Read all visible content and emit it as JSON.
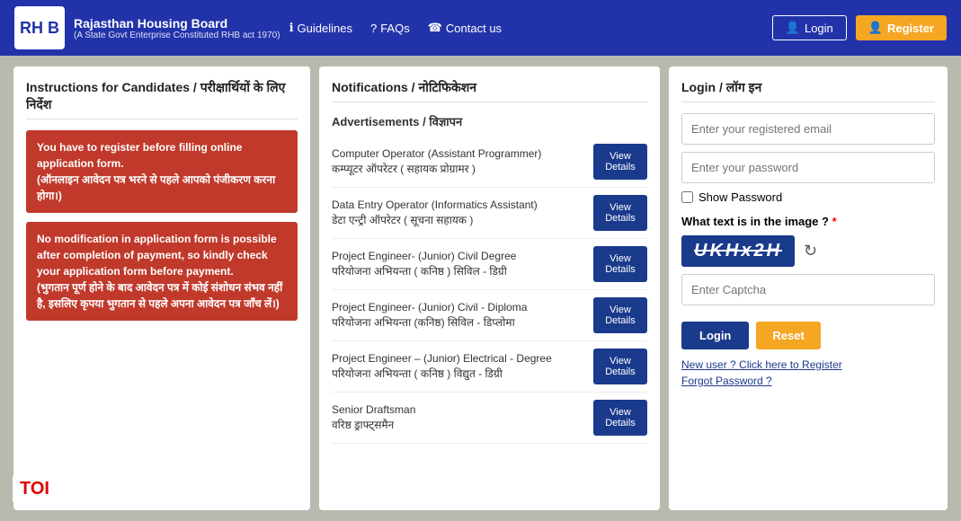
{
  "header": {
    "logo_text": "RH B",
    "org_name": "Rajasthan Housing Board",
    "org_sub": "(A State Govt Enterprise Constituted RHB act 1970)",
    "nav": [
      {
        "id": "guidelines",
        "icon": "ℹ",
        "label": "Guidelines"
      },
      {
        "id": "faqs",
        "icon": "?",
        "label": "FAQs"
      },
      {
        "id": "contact",
        "icon": "☎",
        "label": "Contact us"
      }
    ],
    "login_label": "Login",
    "register_label": "Register"
  },
  "instructions": {
    "section_title": "Instructions for Candidates / परीक्षार्थियों के लिए निर्देश",
    "boxes": [
      {
        "id": "inst1",
        "text": "You have to register before filling online application form.\n(ऑनलाइन आवेदन पत्र भरने से पहले आपको पंजीकरण करना होगा।)"
      },
      {
        "id": "inst2",
        "text": "No modification in application form is possible after completion of payment, so kindly check your application form before payment.\n(भुगतान पूर्ण होने के बाद आवेदन पत्र में कोई संशोधन संभव नहीं है, इसलिए कृपया भुगतान से पहले अपना आवेदन पत्र जाँच लें।)"
      }
    ]
  },
  "notifications": {
    "section_title": "Notifications / नोटिफिकेशन",
    "sub_title": "Advertisements / विज्ञापन",
    "items": [
      {
        "id": "notif1",
        "text": "Computer Operator (Assistant Programmer)\nकम्प्यूटर ऑपरेटर ( सहायक प्रोग्रामर )",
        "btn_label": "View\nDetails"
      },
      {
        "id": "notif2",
        "text": "Data Entry Operator (Informatics Assistant)\nडेटा एन्ट्री ऑपरेटर ( सूचना सहायक )",
        "btn_label": "View\nDetails"
      },
      {
        "id": "notif3",
        "text": "Project Engineer- (Junior) Civil Degree\nपरियोजना अभियन्ता ( कनिष्ठ ) सिविल - डिग्री",
        "btn_label": "View\nDetails"
      },
      {
        "id": "notif4",
        "text": "Project Engineer- (Junior) Civil - Diploma\nपरियोजना अभियन्ता (कनिष्ठ) सिविल - डिप्लोमा",
        "btn_label": "View\nDetails"
      },
      {
        "id": "notif5",
        "text": "Project Engineer – (Junior) Electrical - Degree\nपरियोजना अभियन्ता ( कनिष्ठ ) विद्युत - डिग्री",
        "btn_label": "View\nDetails"
      },
      {
        "id": "notif6",
        "text": "Senior Draftsman\nवरिष्ठ ड्राफ्ट्समैन",
        "btn_label": "View\nDetails"
      }
    ]
  },
  "login": {
    "section_title": "Login / लॉग इन",
    "email_placeholder": "Enter your registered email",
    "password_placeholder": "Enter your password",
    "show_password_label": "Show Password",
    "captcha_label": "What text is in the image ?",
    "captcha_required": "*",
    "captcha_value": "UKHx2H",
    "captcha_input_placeholder": "Enter Captcha",
    "login_btn": "Login",
    "reset_btn": "Reset",
    "register_link": "New user ? Click here to Register",
    "forgot_link": "Forgot Password ?"
  },
  "toi": {
    "label": "TOI"
  }
}
